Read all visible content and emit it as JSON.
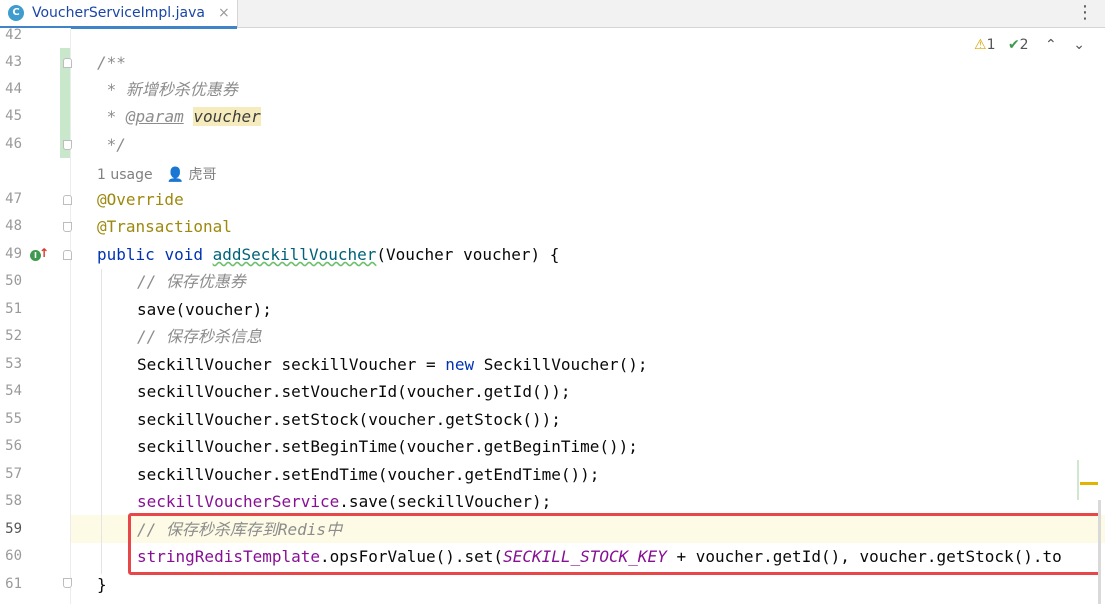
{
  "tab": {
    "icon": "C",
    "title": "VoucherServiceImpl.java",
    "close": "×"
  },
  "toolbar": {
    "more_icon": "⋮"
  },
  "inspections": {
    "warnings": "1",
    "ok": "2",
    "up": "⌃",
    "down": "⌄"
  },
  "line_numbers": [
    "42",
    "43",
    "44",
    "45",
    "46",
    "47",
    "48",
    "49",
    "50",
    "51",
    "52",
    "53",
    "54",
    "55",
    "56",
    "57",
    "58",
    "59",
    "60",
    "61"
  ],
  "inlay": {
    "usages": "1 usage",
    "author": "虎哥"
  },
  "code": {
    "l43": "/**",
    "l44": " * 新增秒杀优惠券",
    "l45_prefix": " * ",
    "l45_tag": "@param",
    "l45_space": " ",
    "l45_name": "voucher",
    "l46": " */",
    "l47": "@Override",
    "l48": "@Transactional",
    "l49_kw1": "public",
    "l49_kw2": "void",
    "l49_fn": "addSeckillVoucher",
    "l49_rest": "(Voucher voucher) {",
    "l50": "// 保存优惠券",
    "l51": "save(voucher);",
    "l52": "// 保存秒杀信息",
    "l53_a": "SeckillVoucher seckillVoucher = ",
    "l53_kw": "new",
    "l53_b": " SeckillVoucher();",
    "l54": "seckillVoucher.setVoucherId(voucher.getId());",
    "l55": "seckillVoucher.setStock(voucher.getStock());",
    "l56": "seckillVoucher.setBeginTime(voucher.getBeginTime());",
    "l57": "seckillVoucher.setEndTime(voucher.getEndTime());",
    "l58_field": "seckillVoucherService",
    "l58_rest": ".save(seckillVoucher);",
    "l59": "// 保存秒杀库存到Redis中",
    "l60_field": "stringRedisTemplate",
    "l60_a": ".opsForValue().set(",
    "l60_const": "SECKILL_STOCK_KEY",
    "l60_b": " + voucher.getId(), voucher.getStock().to",
    "l61": "}"
  },
  "colors": {
    "keyword": "#0033b3",
    "annotation": "#9e880d",
    "comment": "#8c8c8c",
    "field": "#871094",
    "highlight_box": "#e8474a"
  }
}
